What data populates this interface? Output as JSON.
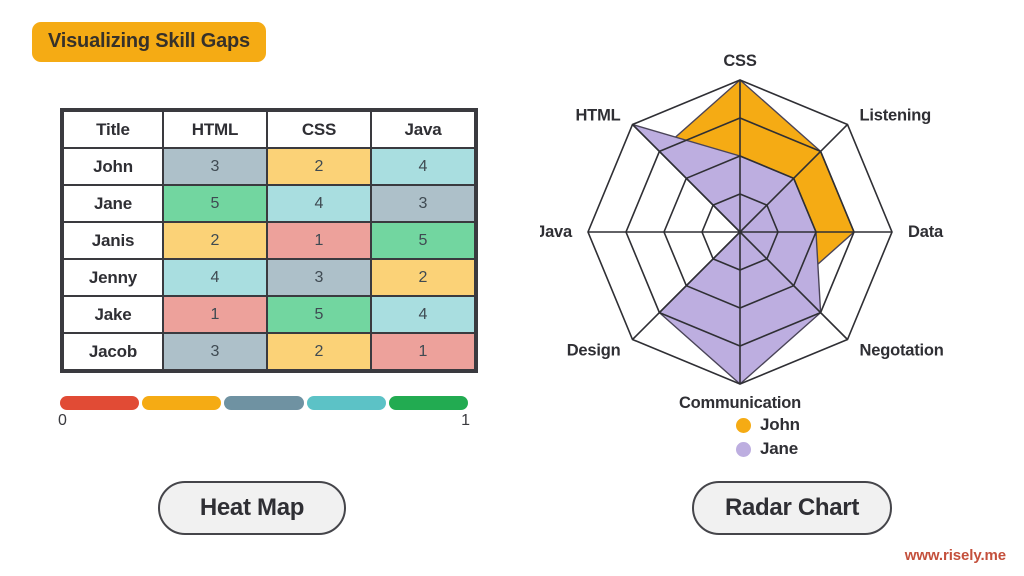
{
  "title": {
    "text": "Visualizing Skill Gaps",
    "pill_color": "#f5ab14"
  },
  "heatmap": {
    "columns": [
      "Title",
      "HTML",
      "CSS",
      "Java"
    ],
    "rows": [
      {
        "name": "John",
        "values": [
          3,
          2,
          4
        ]
      },
      {
        "name": "Jane",
        "values": [
          5,
          4,
          3
        ]
      },
      {
        "name": "Janis",
        "values": [
          2,
          1,
          5
        ]
      },
      {
        "name": "Jenny",
        "values": [
          4,
          3,
          2
        ]
      },
      {
        "name": "Jake",
        "values": [
          1,
          5,
          4
        ]
      },
      {
        "name": "Jacob",
        "values": [
          3,
          2,
          1
        ]
      }
    ],
    "cell_colors": {
      "1": "#eda19b",
      "2": "#fbd277",
      "3": "#adc0c9",
      "4": "#a9dee0",
      "5": "#72d6a0"
    },
    "legend": {
      "swatches": [
        "#e14b35",
        "#f5ab14",
        "#6f92a2",
        "#5cc2c6",
        "#22ab51"
      ],
      "min_label": "0",
      "max_label": "1"
    }
  },
  "radar": {
    "button_label": "Radar Chart",
    "legend": [
      {
        "label": "John",
        "color": "#f5ab14"
      },
      {
        "label": "Jane",
        "color": "#bdaee0"
      }
    ]
  },
  "chart_data": {
    "type": "radar",
    "title": "",
    "axes": [
      "CSS",
      "Listening",
      "Data",
      "Negotation",
      "Communication",
      "Design",
      "Java",
      "HTML"
    ],
    "rings": 4,
    "rmax": 4,
    "grid": true,
    "legend_position": "bottom",
    "series": [
      {
        "name": "John",
        "color": "#f5ab14",
        "values": [
          4,
          3,
          3,
          2,
          2,
          3,
          0,
          3
        ]
      },
      {
        "name": "Jane",
        "color": "#bdaee0",
        "values": [
          2,
          2,
          2,
          3,
          4,
          3,
          0,
          4
        ]
      }
    ]
  },
  "buttons": {
    "heatmap_label": "Heat Map",
    "radar_label": "Radar Chart"
  },
  "watermark": "www.risely.me"
}
